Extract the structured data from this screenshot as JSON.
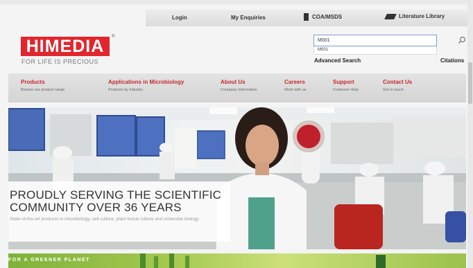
{
  "topbar": {
    "login": "Login",
    "enquiries": "My Enquiries",
    "coa": "COA/MSDS",
    "literature": "Literature Library"
  },
  "brand": {
    "logo": "HIMEDIA",
    "tagline": "FOR LIFE IS PRECIOUS",
    "primary_color": "#e1262d"
  },
  "search": {
    "value": "M001",
    "suggestion": "M001",
    "advanced": "Advanced Search",
    "citations": "Citations"
  },
  "nav": {
    "items": [
      {
        "title": "Products",
        "sub": "Browse our product range"
      },
      {
        "title": "Applications in Microbiology",
        "sub": "Products by industry"
      },
      {
        "title": "About Us",
        "sub": "Company Information"
      },
      {
        "title": "Careers",
        "sub": "Work with us"
      },
      {
        "title": "Support",
        "sub": "Customer Help"
      },
      {
        "title": "Contact Us",
        "sub": "Get in touch"
      }
    ]
  },
  "hero": {
    "headline": "PROUDLY SERVING THE SCIENTIFIC COMMUNITY OVER 36 YEARS",
    "subtext": "State-of-the-art products in microbiology, cell culture, plant tissue culture and molecular biology"
  },
  "banner": {
    "label": "FOR A GREENER PLANET"
  }
}
